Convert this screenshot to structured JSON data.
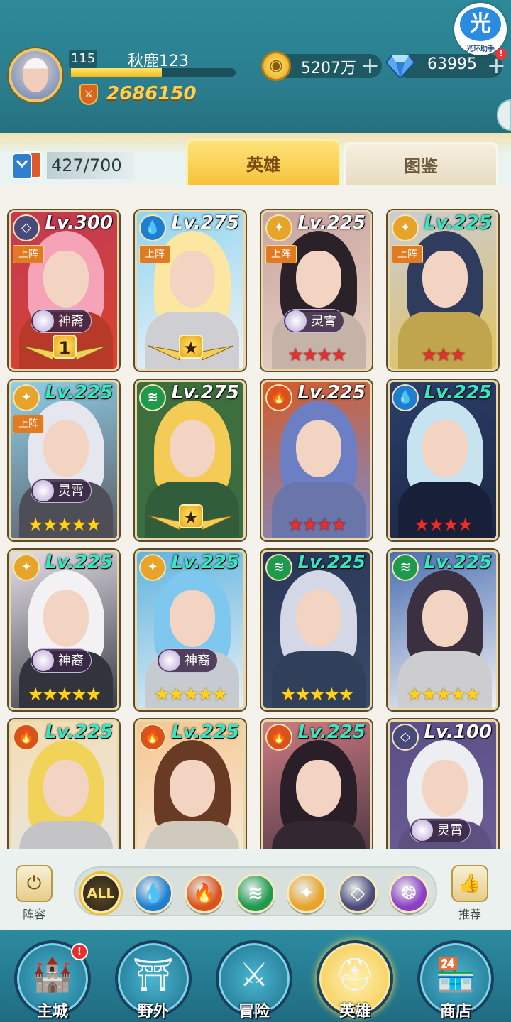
{
  "player": {
    "level": "115",
    "name": "秋鹿123",
    "exp_progress": 0.55,
    "power": "2686150"
  },
  "resources": {
    "gold": "5207万",
    "gems": "63995",
    "plus": "+"
  },
  "helper": {
    "glyph": "光",
    "label": "光环助手",
    "badge": "!"
  },
  "card_count": "427/700",
  "tabs": {
    "heroes": "英雄",
    "handbook": "图鉴"
  },
  "labels": {
    "deployed": "上阵"
  },
  "heroes": [
    {
      "level": "Lv.300",
      "faction": "shadow",
      "deployed": true,
      "class": "神裔",
      "rank_badge": "1",
      "stars": "",
      "star_color": "gold",
      "lv_color": "white"
    },
    {
      "level": "Lv.275",
      "faction": "water",
      "deployed": true,
      "class": "",
      "rank_badge": "★",
      "stars": "",
      "star_color": "gold",
      "lv_color": "white"
    },
    {
      "level": "Lv.225",
      "faction": "light",
      "deployed": true,
      "class": "灵霄",
      "rank_badge": "",
      "stars": "★★★★",
      "star_color": "red",
      "lv_color": "white"
    },
    {
      "level": "Lv.225",
      "faction": "light",
      "deployed": true,
      "class": "",
      "rank_badge": "",
      "stars": "★★★",
      "star_color": "red",
      "lv_color": "green"
    },
    {
      "level": "Lv.225",
      "faction": "light",
      "deployed": true,
      "class": "灵霄",
      "rank_badge": "",
      "stars": "★★★★★",
      "star_color": "gold",
      "lv_color": "green"
    },
    {
      "level": "Lv.275",
      "faction": "wind",
      "deployed": false,
      "class": "",
      "rank_badge": "★",
      "stars": "",
      "star_color": "gold",
      "lv_color": "white"
    },
    {
      "level": "Lv.225",
      "faction": "fire",
      "deployed": false,
      "class": "",
      "rank_badge": "",
      "stars": "★★★★",
      "star_color": "red",
      "lv_color": "white"
    },
    {
      "level": "Lv.225",
      "faction": "water",
      "deployed": false,
      "class": "",
      "rank_badge": "",
      "stars": "★★★★",
      "star_color": "red",
      "lv_color": "green"
    },
    {
      "level": "Lv.225",
      "faction": "light",
      "deployed": false,
      "class": "神裔",
      "rank_badge": "",
      "stars": "★★★★★",
      "star_color": "gold",
      "lv_color": "green"
    },
    {
      "level": "Lv.225",
      "faction": "light",
      "deployed": false,
      "class": "神裔",
      "rank_badge": "",
      "stars": "★★★★★",
      "star_color": "gold",
      "lv_color": "green"
    },
    {
      "level": "Lv.225",
      "faction": "wind",
      "deployed": false,
      "class": "",
      "rank_badge": "",
      "stars": "★★★★★",
      "star_color": "gold",
      "lv_color": "green"
    },
    {
      "level": "Lv.225",
      "faction": "wind",
      "deployed": false,
      "class": "",
      "rank_badge": "",
      "stars": "★★★★★",
      "star_color": "gold",
      "lv_color": "green"
    },
    {
      "level": "Lv.225",
      "faction": "fire",
      "deployed": false,
      "class": "",
      "rank_badge": "",
      "stars": "",
      "star_color": "gold",
      "lv_color": "green"
    },
    {
      "level": "Lv.225",
      "faction": "fire",
      "deployed": false,
      "class": "",
      "rank_badge": "",
      "stars": "",
      "star_color": "gold",
      "lv_color": "green"
    },
    {
      "level": "Lv.225",
      "faction": "fire",
      "deployed": false,
      "class": "",
      "rank_badge": "",
      "stars": "",
      "star_color": "gold",
      "lv_color": "green"
    },
    {
      "level": "Lv.100",
      "faction": "shadow",
      "deployed": false,
      "class": "灵霄",
      "rank_badge": "",
      "stars": "",
      "star_color": "gold",
      "lv_color": "white"
    }
  ],
  "filters": {
    "lineup": "阵容",
    "all": "ALL",
    "recommend": "推荐",
    "factions": [
      "water",
      "fire",
      "wind",
      "light",
      "shadow",
      "arcane"
    ]
  },
  "faction_colors": {
    "water": "#1e7fd0",
    "fire": "#d9521c",
    "wind": "#1f9a4c",
    "light": "#e8a42a",
    "shadow": "#4a4a7a",
    "arcane": "#8a3fc4"
  },
  "nav": {
    "items": [
      {
        "label": "主城",
        "icon": "castle-icon",
        "glyph": "🏰",
        "badge": "!"
      },
      {
        "label": "野外",
        "icon": "portal-icon",
        "glyph": "⛩",
        "badge": ""
      },
      {
        "label": "冒险",
        "icon": "sword-icon",
        "glyph": "⚔",
        "badge": ""
      },
      {
        "label": "英雄",
        "icon": "helmet-icon",
        "glyph": "⛑",
        "badge": ""
      },
      {
        "label": "商店",
        "icon": "shop-icon",
        "glyph": "🏪",
        "badge": ""
      }
    ],
    "active": "英雄"
  }
}
